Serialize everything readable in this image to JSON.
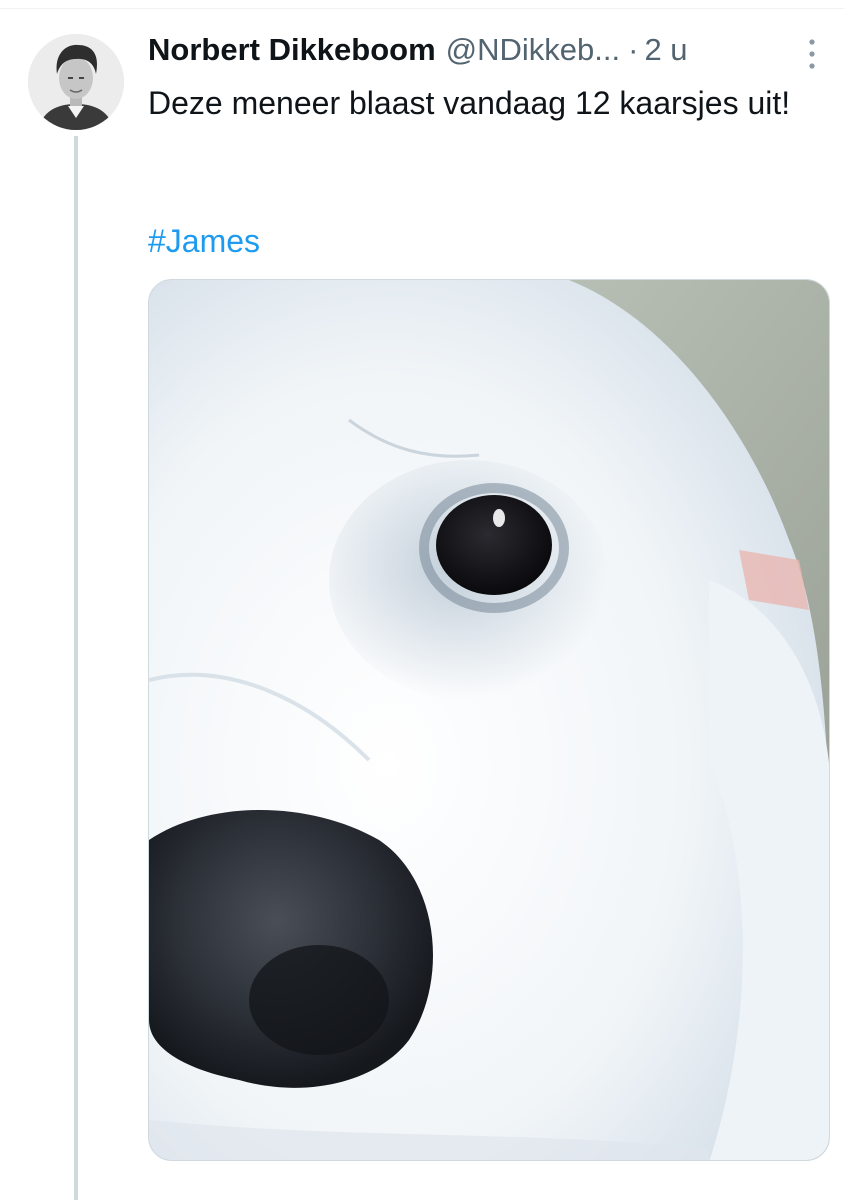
{
  "tweet": {
    "author": {
      "display_name": "Norbert Dikkeboom",
      "handle": "@NDikkeb...",
      "avatar_icon": "person-portrait-avatar"
    },
    "separator": "·",
    "time": "2 u",
    "more_icon": "vertical-ellipsis-icon",
    "text": "Deze meneer blaast vandaag 12 kaarsjes uit!",
    "hashtag": "#James",
    "media": {
      "type": "photo",
      "subject": "close-up of white dog face"
    }
  },
  "colors": {
    "text": "#0f1419",
    "secondary": "#536471",
    "link": "#1d9bf0",
    "border": "#cfd9de",
    "thread_line": "#cfd9de"
  }
}
